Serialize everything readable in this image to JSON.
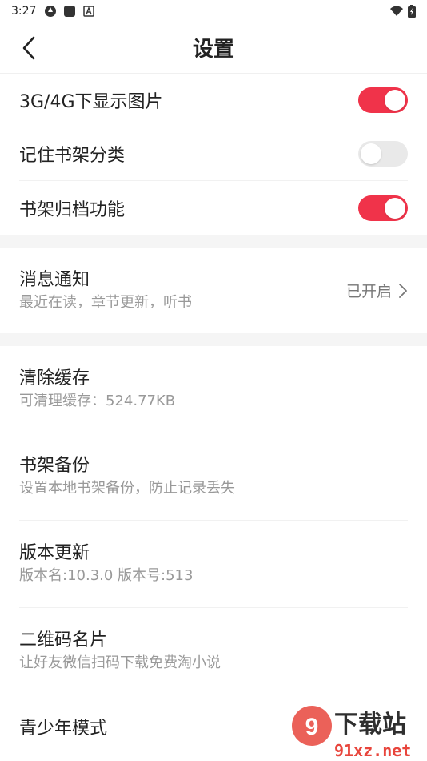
{
  "status_bar": {
    "time": "3:27"
  },
  "nav": {
    "title": "设置"
  },
  "toggles": [
    {
      "label": "3G/4G下显示图片",
      "on": true
    },
    {
      "label": "记住书架分类",
      "on": false
    },
    {
      "label": "书架归档功能",
      "on": true
    }
  ],
  "notify": {
    "title": "消息通知",
    "subtitle": "最近在读，章节更新，听书",
    "status": "已开启"
  },
  "items": [
    {
      "title": "清除缓存",
      "subtitle": "可清理缓存：524.77KB"
    },
    {
      "title": "书架备份",
      "subtitle": "设置本地书架备份，防止记录丢失"
    },
    {
      "title": "版本更新",
      "subtitle": "版本名:10.3.0  版本号:513"
    },
    {
      "title": "二维码名片",
      "subtitle": "让好友微信扫码下载免费淘小说"
    },
    {
      "title": "青少年模式"
    }
  ],
  "watermark": {
    "text": "下载站",
    "url_text": "91xz.net"
  },
  "colors": {
    "accent": "#f0334a",
    "switch_off": "#e9e9e9",
    "divider": "#f5f5f5"
  }
}
